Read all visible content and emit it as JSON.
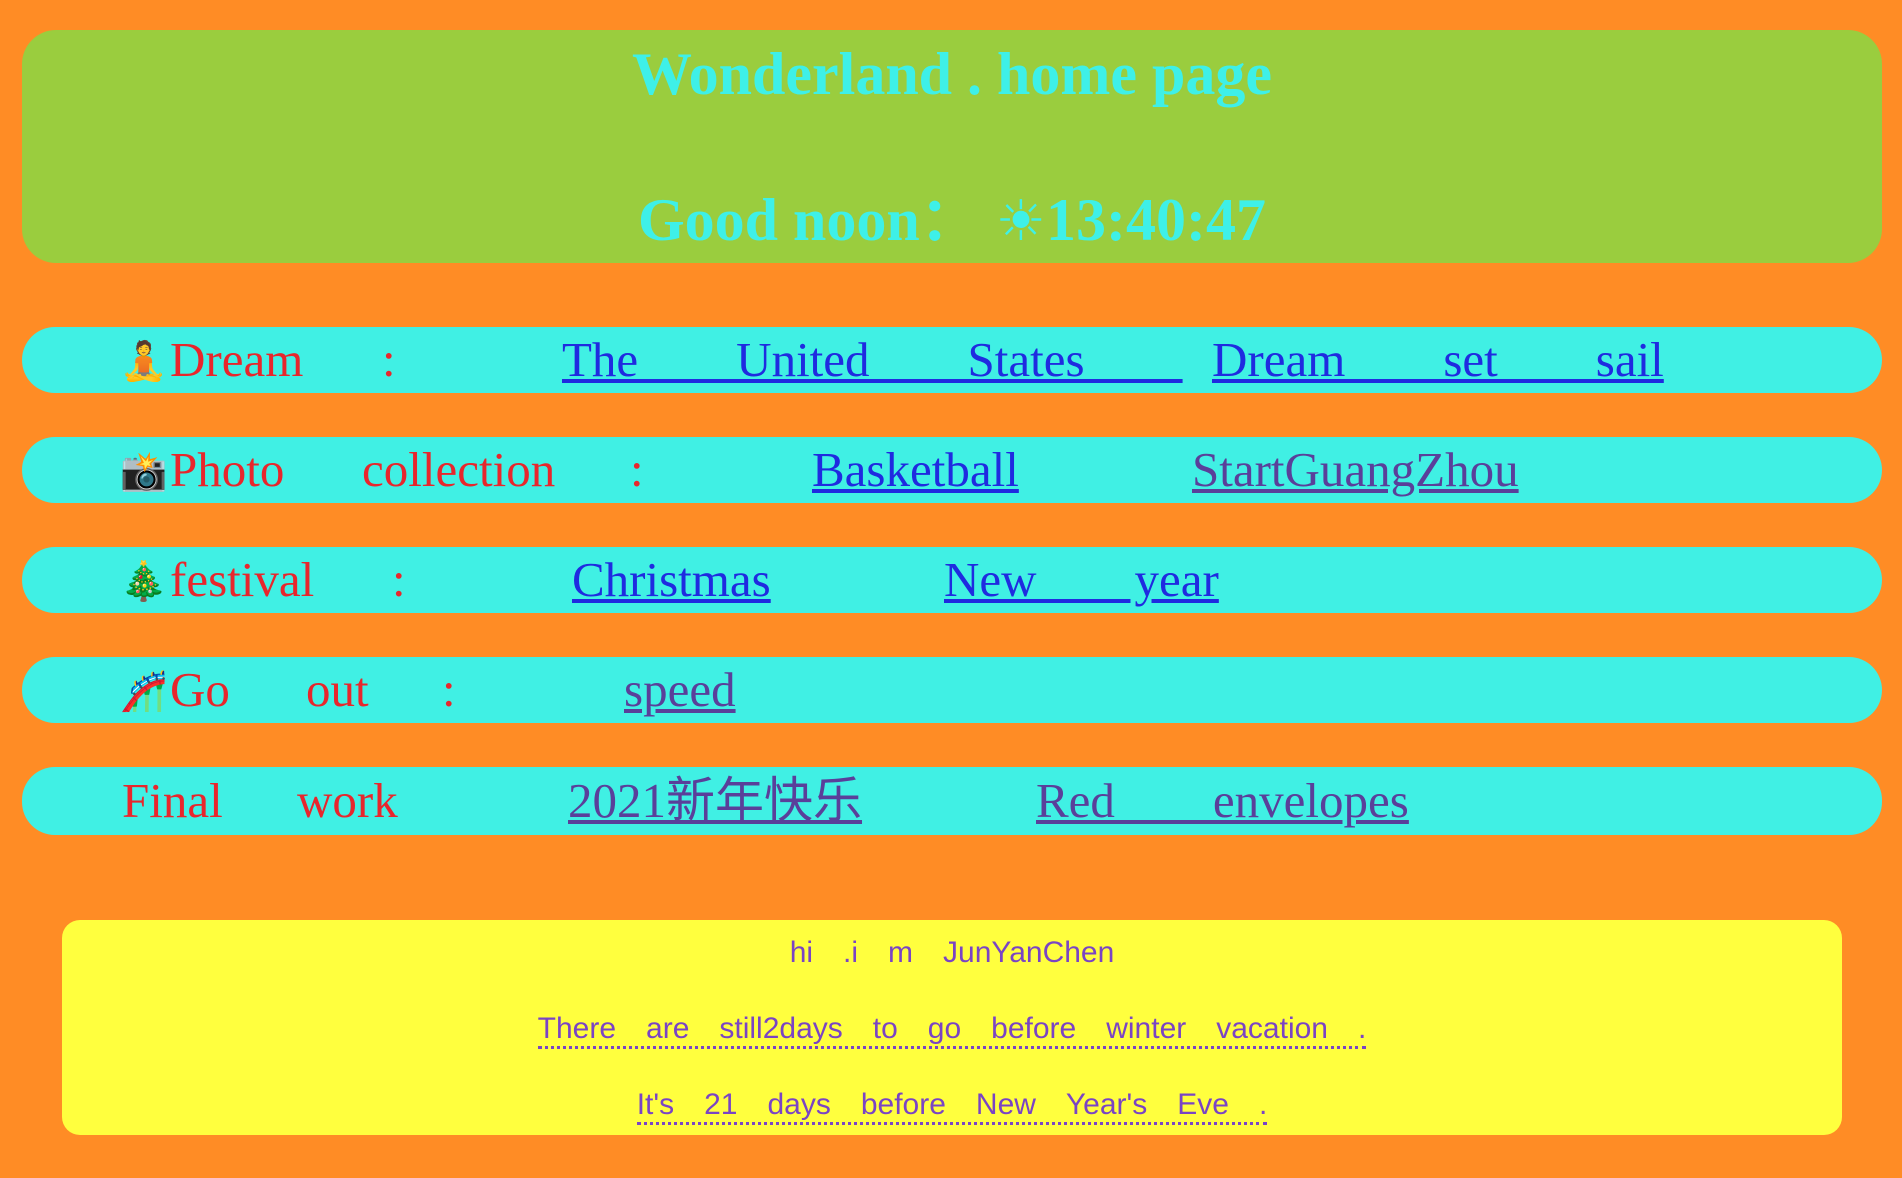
{
  "header": {
    "title": "Wonderland . home page",
    "greeting": "Good noon：",
    "weather_icon": "sun-icon",
    "weather_glyph": "☀",
    "time": "13:40:47"
  },
  "colors": {
    "page_bg": "#ff8c25",
    "header_bg": "#9acd3e",
    "header_text": "#3ef0e8",
    "row_bg": "#40f0e4",
    "label_text": "#e8262c",
    "link": "#1f2be0",
    "link_visited": "#5a3f9a",
    "footer_bg": "#ffff3e",
    "footer_text": "#7a44c4"
  },
  "rows": {
    "dream": {
      "icon": "meditating-person-icon",
      "glyph": "🧘",
      "label_1": "Dream",
      "label_2": ":",
      "links": [
        "The　　United　　States　　",
        "Dream　　set　　sail"
      ]
    },
    "photo": {
      "icon": "camera-flash-icon",
      "glyph": "📸",
      "label_1": "Photo",
      "label_2": "collection",
      "label_3": ":",
      "links": [
        "Basketball",
        "StartGuangZhou"
      ]
    },
    "festival": {
      "icon": "christmas-tree-icon",
      "glyph": "🎄",
      "label_1": "festival",
      "label_2": ":",
      "links": [
        "Christmas",
        "New　　year"
      ]
    },
    "go_out": {
      "icon": "roller-coaster-icon",
      "glyph": "🎢",
      "label_1": "Go",
      "label_2": "out",
      "label_3": ":",
      "links": [
        "speed"
      ]
    },
    "final_work": {
      "label_1": "Final",
      "label_2": "work",
      "links": [
        "2021新年快乐",
        "Red　　envelopes"
      ]
    }
  },
  "footer": {
    "intro": "hi　.i　m　JunYanChen",
    "winter_countdown": "There　are　still2days　to　go　before　winter　vacation　.",
    "newyear_countdown": "It's　21　days　before　New　Year's　Eve　."
  }
}
